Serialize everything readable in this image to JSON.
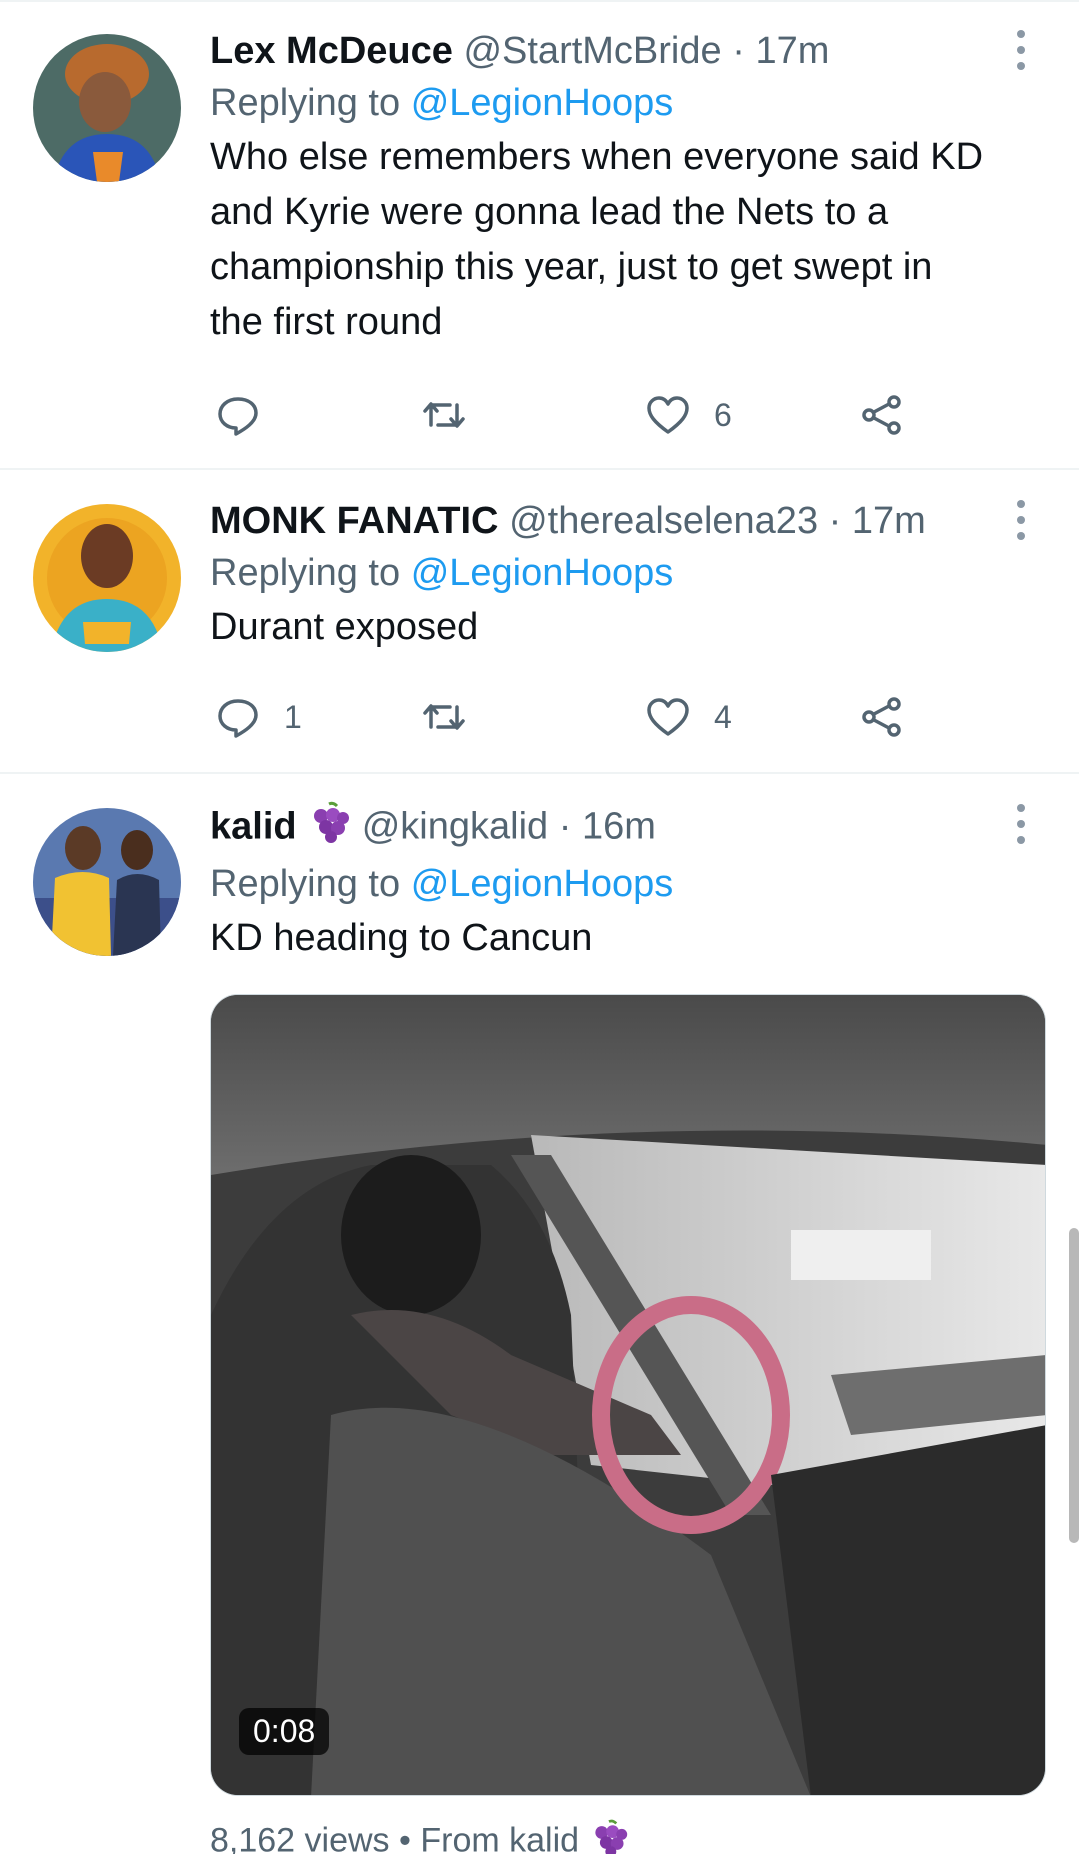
{
  "colors": {
    "link": "#1d9bf0",
    "muted": "#536471",
    "text": "#0f1419",
    "divider": "#eff3f4"
  },
  "tweets": [
    {
      "name": "Lex McDeuce",
      "handle": "@StartMcBride",
      "sep": "·",
      "time": "17m",
      "replying_prefix": "Replying to",
      "replying_to": "@LegionHoops",
      "text_lines": [
        "Who else remembers when everyone said KD",
        "and Kyrie were gonna lead the Nets to a",
        "championship this year, just to get swept in",
        "the first round"
      ],
      "reply_count": "",
      "like_count": "6"
    },
    {
      "name": "MONK FANATIC",
      "handle": "@therealselena23",
      "sep": "·",
      "time": "17m",
      "replying_prefix": "Replying to",
      "replying_to": "@LegionHoops",
      "text_lines": [
        "Durant exposed"
      ],
      "reply_count": "1",
      "like_count": "4"
    },
    {
      "name": "kalid",
      "name_emoji": "grapes-emoji",
      "handle": "@kingkalid",
      "sep": "·",
      "time": "16m",
      "replying_prefix": "Replying to",
      "replying_to": "@LegionHoops",
      "text_lines": [
        "KD heading to Cancun"
      ],
      "video_duration": "0:08",
      "views": "8,162 views",
      "bullet": "•",
      "from": "From kalid"
    }
  ]
}
